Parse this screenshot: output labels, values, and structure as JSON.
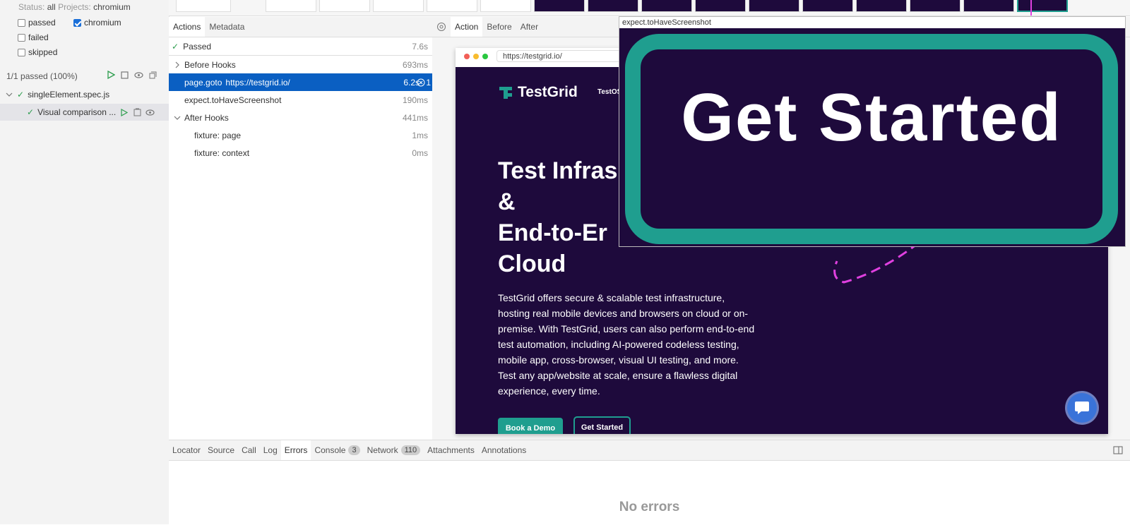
{
  "sidebar": {
    "status_label": "Status:",
    "status_value": "all",
    "projects_label": "Projects:",
    "projects_value": "chromium",
    "filters": [
      {
        "label": "passed",
        "checked": false
      },
      {
        "label": "chromium",
        "checked": true
      },
      {
        "label": "failed",
        "checked": false
      },
      {
        "label": "skipped",
        "checked": false
      }
    ],
    "summary": "1/1 passed (100%)",
    "spec_file": "singleElement.spec.js",
    "test_title": "Visual comparison ..."
  },
  "actions_panel": {
    "tabs": [
      "Actions",
      "Metadata"
    ],
    "result_label": "Passed",
    "result_duration": "7.6s",
    "rows": [
      {
        "label": "Before Hooks",
        "duration": "693ms"
      },
      {
        "label": "page.goto",
        "url": "https://testgrid.io/",
        "duration": "6.2s",
        "badge": "1"
      },
      {
        "label": "expect.toHaveScreenshot",
        "duration": "190ms"
      },
      {
        "label": "After Hooks",
        "duration": "441ms"
      },
      {
        "label": "fixture: page",
        "duration": "1ms"
      },
      {
        "label": "fixture: context",
        "duration": "0ms"
      }
    ]
  },
  "snapshot": {
    "tabs": [
      "Action",
      "Before",
      "After"
    ],
    "url": "https://testgrid.io/",
    "popup_label": "expect.toHaveScreenshot",
    "zoom_text": "Get Started"
  },
  "site": {
    "logo": "TestGrid",
    "nav_item": "TestOS",
    "hero_lines": [
      "Test Infras",
      "&",
      "End-to-Er",
      "Cloud"
    ],
    "description": "TestGrid offers secure & scalable test infrastructure, hosting real mobile devices and browsers on cloud or on-premise. With TestGrid, users can also perform end-to-end test automation, including AI-powered codeless testing, mobile app, cross-browser, visual UI testing, and more. Test any app/website at scale, ensure a flawless digital experience, every time.",
    "btn_demo": "Book a Demo",
    "btn_start": "Get Started"
  },
  "bottom_panel": {
    "tabs": [
      "Locator",
      "Source",
      "Call",
      "Log",
      "Errors",
      "Console",
      "Network",
      "Attachments",
      "Annotations"
    ],
    "console_count": "3",
    "network_count": "110",
    "empty_message": "No errors"
  },
  "colors": {
    "accent": "#0a5fc2",
    "pass_green": "#2e9e4f",
    "site_bg": "#1e0a3c",
    "teal": "#1f9e8f",
    "highlight": "#e040e0"
  }
}
